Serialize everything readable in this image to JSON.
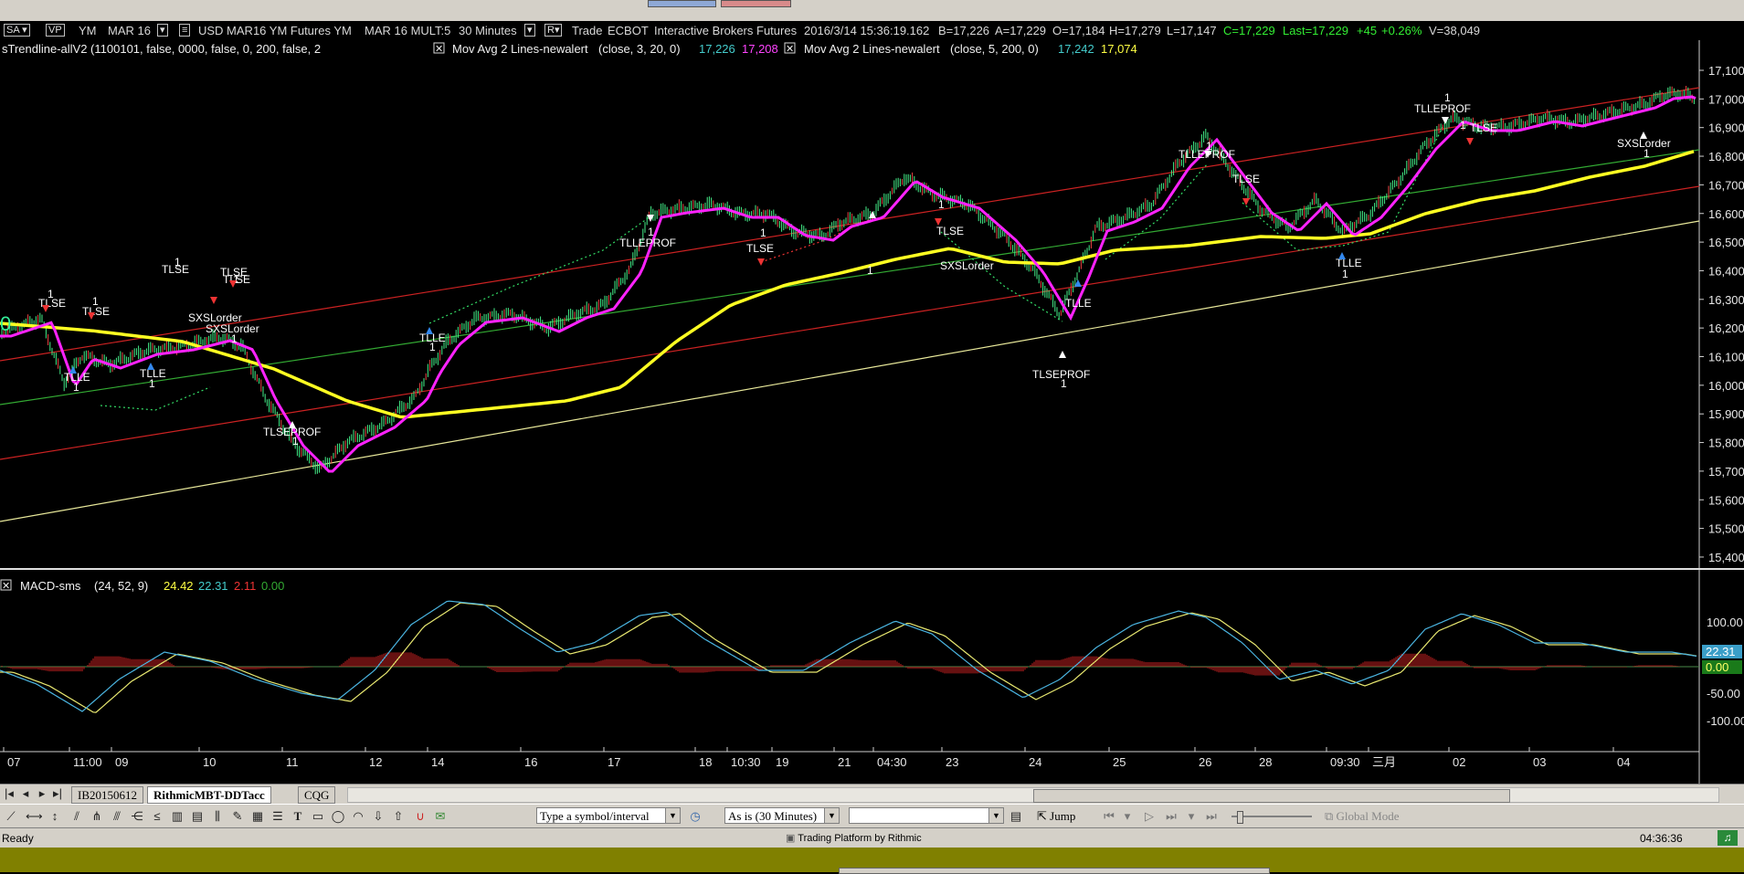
{
  "titlebar": {
    "sa": "SA",
    "vp": "VP",
    "ym": "YM",
    "expiry": "MAR 16",
    "description": "USD MAR16 YM Futures YM",
    "mult": "MAR 16 MULT:5",
    "interval": "30 Minutes",
    "r_label": "R",
    "trade": "Trade",
    "exchange": "ECBOT",
    "broker": "Interactive Brokers",
    "instrument_type": "Futures",
    "datetime": "2016/3/14   15:36:19.162",
    "bid": "B=17,226",
    "ask": "A=17,229",
    "open": "O=17,184",
    "high": "H=17,279",
    "low": "L=17,147",
    "close": "C=17,229",
    "last": "Last=17,229",
    "change": "+45",
    "change_pct": "+0.26%",
    "volume": "V=38,049"
  },
  "price_pane": {
    "study_label": "sTrendline-allV2 (1100101, false, 0000, false, 0, 200, false, 2",
    "ma1": {
      "name": "Mov Avg 2 Lines-newalert",
      "params": "(close,  3,  20,  0)",
      "v1": "17,226",
      "v2": "17,208"
    },
    "ma2": {
      "name": "Mov Avg 2 Lines-newalert",
      "params": "(close,  5,  200,  0)",
      "v1": "17,242",
      "v2": "17,074"
    },
    "edge_label": "0",
    "y_ticks": [
      "17,100",
      "17,000",
      "16,900",
      "16,800",
      "16,700",
      "16,600",
      "16,500",
      "16,400",
      "16,300",
      "16,200",
      "16,100",
      "16,000",
      "15,900",
      "15,800",
      "15,700",
      "15,600",
      "15,500",
      "15,400"
    ]
  },
  "macd_pane": {
    "label": "MACD-sms",
    "params": "(24,  52,  9)",
    "v1": "24.42",
    "v2": "22.31",
    "v3": "2.11",
    "v4": "0.00",
    "y_ticks": [
      "100.00",
      "50.00",
      "-50.00",
      "-100.00"
    ],
    "badge_macd": "22.31",
    "badge_zero": "0.00"
  },
  "x_axis": {
    "ticks": [
      "07",
      "11:00",
      "09",
      "10",
      "11",
      "12",
      "14",
      "16",
      "17",
      "18",
      "10:30",
      "19",
      "21",
      "04:30",
      "23",
      "24",
      "25",
      "26",
      "28",
      "09:30",
      "三月",
      "02",
      "03",
      "04"
    ]
  },
  "annotations": [
    {
      "t": "1"
    },
    {
      "t": "TLSE"
    },
    {
      "t": "1"
    },
    {
      "t": "TLSE"
    },
    {
      "t": "TLLE"
    },
    {
      "t": "1"
    },
    {
      "t": "TLLE"
    },
    {
      "t": "1"
    },
    {
      "t": "1"
    },
    {
      "t": "TLSE"
    },
    {
      "t": "TLSE"
    },
    {
      "t": "1"
    },
    {
      "t": "TLSE"
    },
    {
      "t": "SXSLorder"
    },
    {
      "t": "SXSLorder"
    },
    {
      "t": "1"
    },
    {
      "t": "TLSEPROF"
    },
    {
      "t": "1"
    },
    {
      "t": "TLLE"
    },
    {
      "t": "1"
    },
    {
      "t": "TLLEPROF"
    },
    {
      "t": "1"
    },
    {
      "t": "TLSE"
    },
    {
      "t": "1"
    },
    {
      "t": "TLSE"
    },
    {
      "t": "SXSLorder"
    },
    {
      "t": "1"
    },
    {
      "t": "TLLE"
    },
    {
      "t": "TLSEPROF"
    },
    {
      "t": "1"
    },
    {
      "t": "1"
    },
    {
      "t": "TLLEPROF"
    },
    {
      "t": "TLSE"
    },
    {
      "t": "TLLE"
    },
    {
      "t": "1"
    },
    {
      "t": "1"
    },
    {
      "t": "TLLEPROF"
    },
    {
      "t": "1"
    },
    {
      "t": "TLSE"
    },
    {
      "t": "SXSLorder"
    },
    {
      "t": "1"
    },
    {
      "t": "1"
    }
  ],
  "tabs": [
    "IB20150612",
    "RithmicMBT-DDTacc",
    "CQG"
  ],
  "toolbar": {
    "symbol_placeholder": "Type a symbol/interval",
    "interval_select": "As is (30 Minutes)",
    "jump": "Jump",
    "global_mode": "Global Mode"
  },
  "status": {
    "ready": "Ready",
    "platform": "Trading Platform by Rithmic",
    "clock": "04:36:36"
  },
  "colors": {
    "background": "#000000",
    "ma_fast": "#ff22ff",
    "ma_slow": "#ffff22",
    "channel_red": "#cc2222",
    "channel_green": "#33aa33",
    "trend_light": "#e8e89a",
    "up_change": "#33ee33",
    "macd_line": "#4ab4e0",
    "signal_line": "#e8e870"
  },
  "icons": [
    "first-tab-icon",
    "prev-tab-icon",
    "next-tab-icon",
    "last-tab-icon",
    "draw-line-icon",
    "horizontal-line-icon",
    "vertical-line-icon",
    "fib-icon",
    "pitchfork-icon",
    "text-icon",
    "rectangle-icon",
    "ellipse-icon",
    "arc-icon",
    "arrow-down-icon",
    "arrow-up-icon",
    "magnet-icon",
    "calendar-icon",
    "back-icon",
    "forward-icon",
    "speaker-icon"
  ]
}
